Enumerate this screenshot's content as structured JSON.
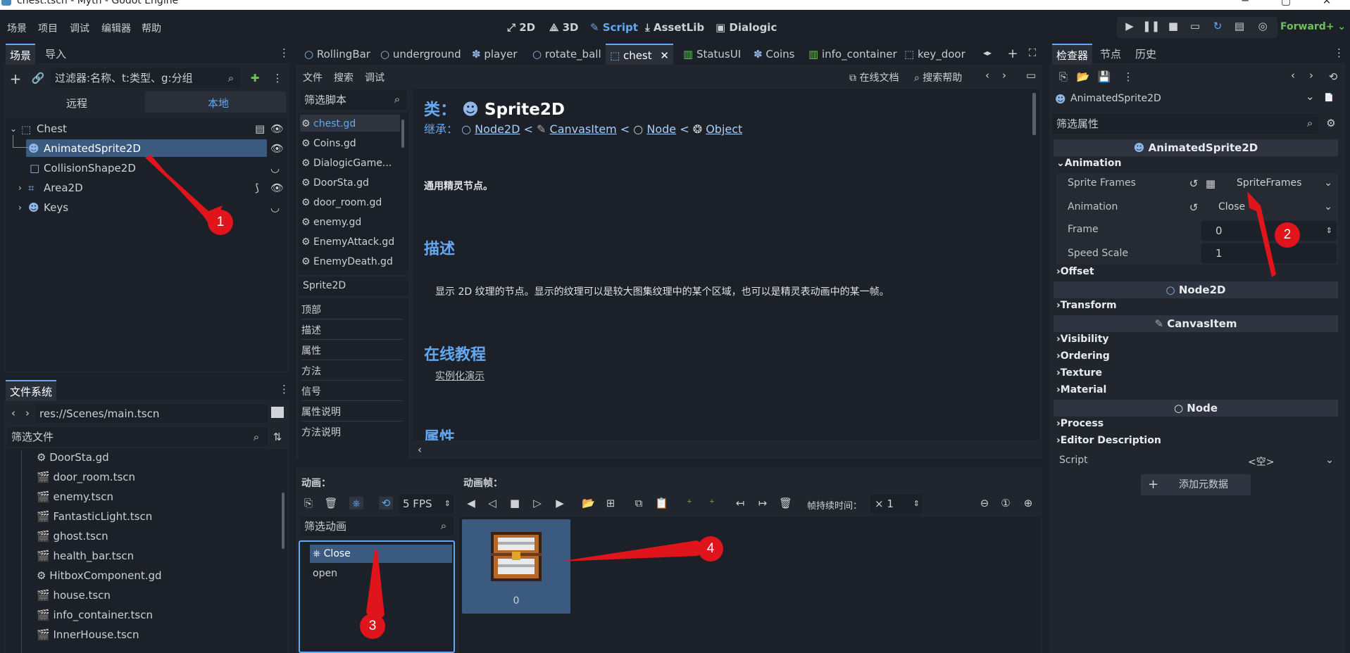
{
  "window": {
    "title": "chest.tscn - Myth - Godot Engine"
  },
  "menu": [
    "场景",
    "项目",
    "调试",
    "编辑器",
    "帮助"
  ],
  "main_tabs": [
    "2D",
    "3D",
    "Script",
    "AssetLib",
    "Dialogic"
  ],
  "renderer": "Forward+",
  "scene_dock": {
    "tabs": [
      "场景",
      "导入"
    ],
    "filter_placeholder": "过滤器:名称、t:类型、g:分组",
    "remote": "远程",
    "local": "本地",
    "nodes": [
      {
        "name": "Chest",
        "level": 0,
        "icon": "node2d-icon"
      },
      {
        "name": "AnimatedSprite2D",
        "level": 1,
        "icon": "animated-sprite-icon",
        "selected": true
      },
      {
        "name": "CollisionShape2D",
        "level": 1,
        "icon": "collision-shape-icon"
      },
      {
        "name": "Area2D",
        "level": 1,
        "icon": "area2d-icon"
      },
      {
        "name": "Keys",
        "level": 1,
        "icon": "keys-icon"
      }
    ]
  },
  "filesystem": {
    "title": "文件系统",
    "path": "res://Scenes/main.tscn",
    "filter_placeholder": "筛选文件",
    "files": [
      {
        "name": "DoorSta.gd",
        "type": "script"
      },
      {
        "name": "door_room.tscn",
        "type": "scene"
      },
      {
        "name": "enemy.tscn",
        "type": "scene"
      },
      {
        "name": "FantasticLight.tscn",
        "type": "scene"
      },
      {
        "name": "ghost.tscn",
        "type": "scene"
      },
      {
        "name": "health_bar.tscn",
        "type": "scene"
      },
      {
        "name": "HitboxComponent.gd",
        "type": "script"
      },
      {
        "name": "house.tscn",
        "type": "scene"
      },
      {
        "name": "info_container.tscn",
        "type": "scene"
      },
      {
        "name": "InnerHouse.tscn",
        "type": "scene"
      }
    ]
  },
  "editor_tabs": [
    "RollingBar",
    "underground",
    "player",
    "rotate_ball",
    "chest",
    "StatusUI",
    "Coins",
    "info_container",
    "key_door"
  ],
  "script_menu": [
    "文件",
    "搜索",
    "调试"
  ],
  "script_toolbar": {
    "online_docs": "在线文档",
    "search_help": "搜索帮助"
  },
  "script_list": {
    "filter_placeholder": "筛选脚本",
    "scripts": [
      "chest.gd",
      "Coins.gd",
      "DialogicGame...",
      "DoorSta.gd",
      "door_room.gd",
      "enemy.gd",
      "EnemyAttack.gd",
      "EnemyDeath.gd"
    ],
    "current": "Sprite2D",
    "outline": [
      "顶部",
      "描述",
      "属性",
      "方法",
      "信号",
      "属性说明",
      "方法说明"
    ]
  },
  "doc": {
    "class_prefix": "类：",
    "class_name": "Sprite2D",
    "inherits_label": "继承：",
    "inherits": [
      "Node2D",
      "CanvasItem",
      "Node",
      "Object"
    ],
    "brief": "通用精灵节点。",
    "description_title": "描述",
    "description": "显示 2D 纹理的节点。显示的纹理可以是较大图集纹理中的某个区域，也可以是精灵表动画中的某一帧。",
    "tutorials_title": "在线教程",
    "tutorial_link": "实例化演示",
    "properties_title": "属性"
  },
  "sprite_frames": {
    "animations_label": "动画：",
    "frames_label": "动画帧：",
    "fps": "5 FPS",
    "frame_duration_label": "帧持续时间：",
    "frame_duration": "× 1",
    "filter_placeholder": "筛选动画",
    "animations": [
      "Close",
      "open"
    ],
    "selected_animation": "Close",
    "frames": [
      "0"
    ]
  },
  "inspector": {
    "tabs": [
      "检查器",
      "节点",
      "历史"
    ],
    "object": "AnimatedSprite2D",
    "filter_placeholder": "筛选属性",
    "class_header": "AnimatedSprite2D",
    "animation_category": "Animation",
    "props": {
      "sprite_frames_label": "Sprite Frames",
      "sprite_frames_value": "SpriteFrames",
      "animation_label": "Animation",
      "animation_value": "Close",
      "frame_label": "Frame",
      "frame_value": "0",
      "speed_label": "Speed Scale",
      "speed_value": "1"
    },
    "offset": "Offset",
    "node2d_header": "Node2D",
    "transform": "Transform",
    "canvas_header": "CanvasItem",
    "canvas_cats": [
      "Visibility",
      "Ordering",
      "Texture",
      "Material"
    ],
    "node_header": "Node",
    "process": "Process",
    "editor_description": "Editor Description",
    "script_label": "Script",
    "script_value": "<空>",
    "add_metadata": "添加元数据"
  },
  "annotations": [
    "1",
    "2",
    "3",
    "4"
  ],
  "colors": {
    "accent": "#63a8f0",
    "selection": "#3a5a80",
    "arrow": "#e0141b",
    "renderer": "#6ec05a"
  }
}
